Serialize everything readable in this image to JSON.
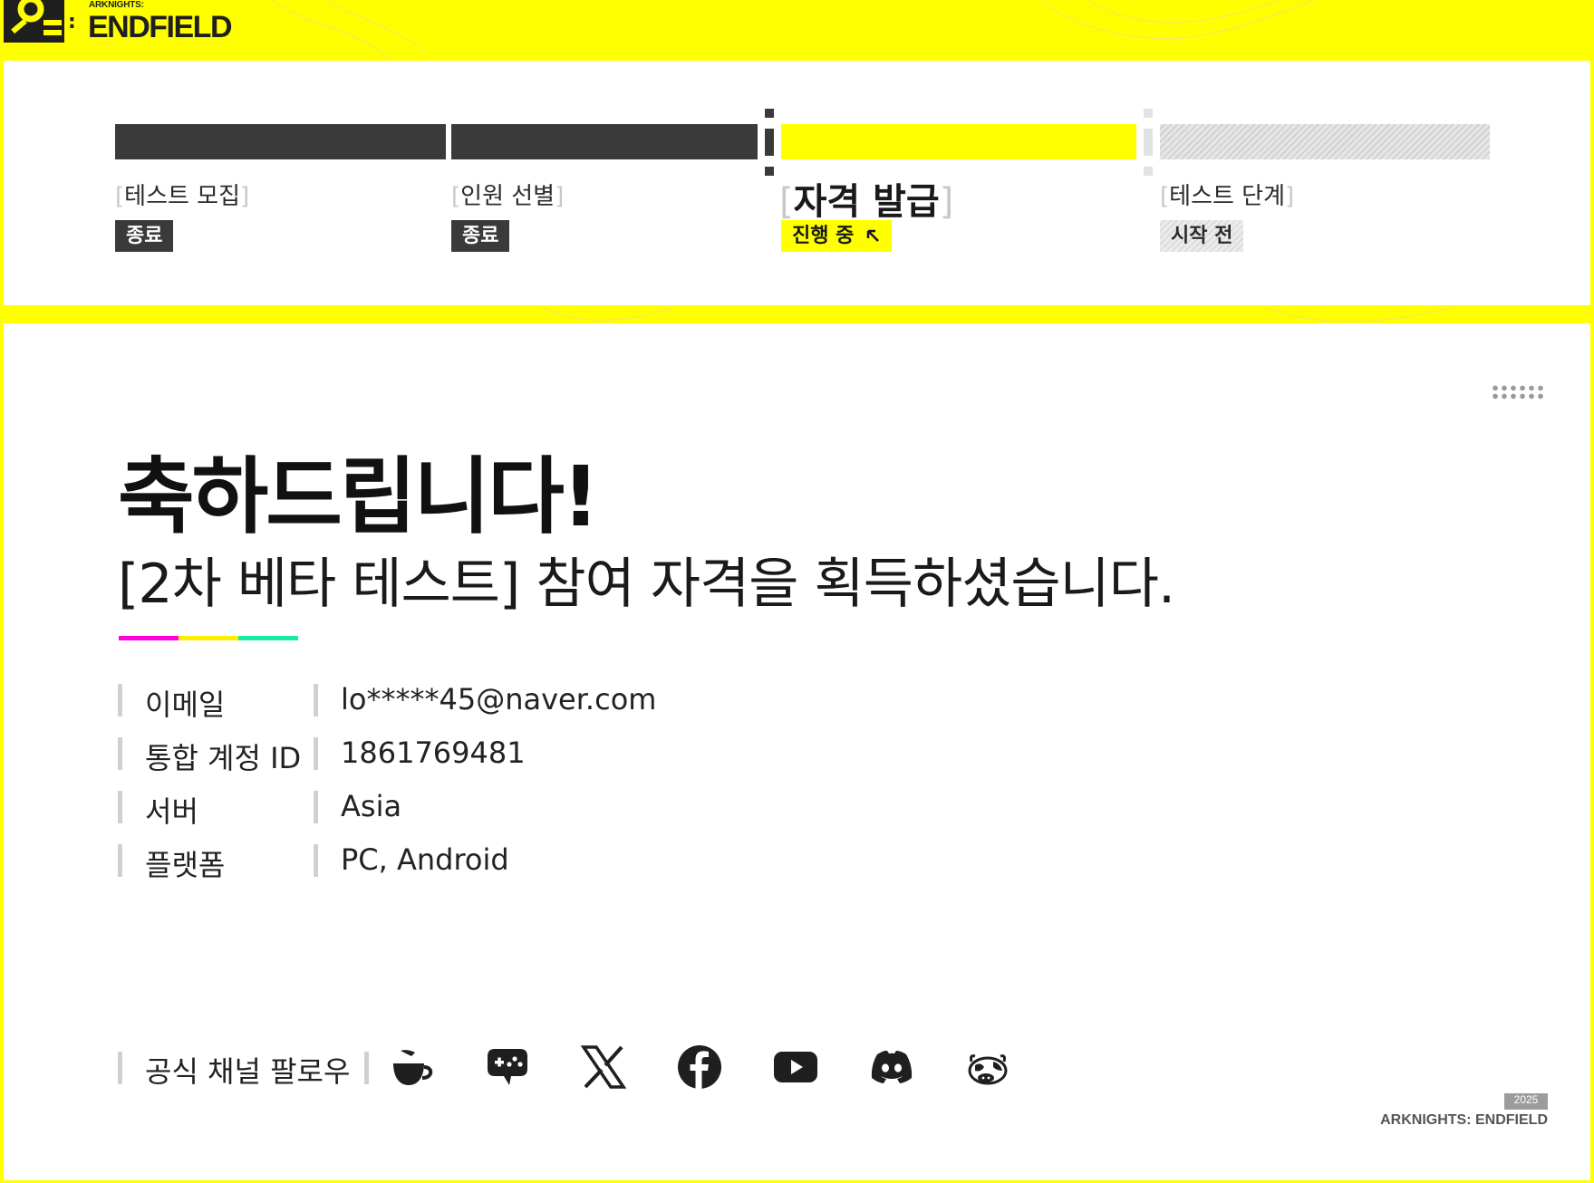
{
  "header": {
    "logo_small": "ARKNIGHTS:",
    "logo_big": "ENDFIELD"
  },
  "steps": [
    {
      "label": "테스트 모집",
      "status": "종료",
      "state": "done"
    },
    {
      "label": "인원 선별",
      "status": "종료",
      "state": "done"
    },
    {
      "label": "자격 발급",
      "status": "진행 중",
      "state": "active"
    },
    {
      "label": "테스트 단계",
      "status": "시작 전",
      "state": "pending"
    }
  ],
  "bracket_open": "[",
  "bracket_close": "]",
  "main": {
    "title": "축하드립니다!",
    "subtitle": "[2차 베타 테스트] 참여 자격을 획득하셨습니다.",
    "info": [
      {
        "label": "이메일",
        "value": "lo*****45@naver.com"
      },
      {
        "label": "통합 계정 ID",
        "value": "1861769481"
      },
      {
        "label": "서버",
        "value": "Asia"
      },
      {
        "label": "플랫폼",
        "value": "PC, Android"
      }
    ],
    "follow_label": "공식 채널 팔로우",
    "social_icons": [
      "cup-icon",
      "gamepad-chat-icon",
      "x-icon",
      "facebook-icon",
      "youtube-icon",
      "discord-icon",
      "cow-mascot-icon"
    ]
  },
  "footer": {
    "year": "2025",
    "brand": "ARKNIGHTS: ENDFIELD"
  },
  "colors": {
    "accent": "#ffff00",
    "dark": "#3a3a3a",
    "stripe_magenta": "#ff00dd",
    "stripe_yellow": "#ffee00",
    "stripe_teal": "#19e8a8"
  }
}
